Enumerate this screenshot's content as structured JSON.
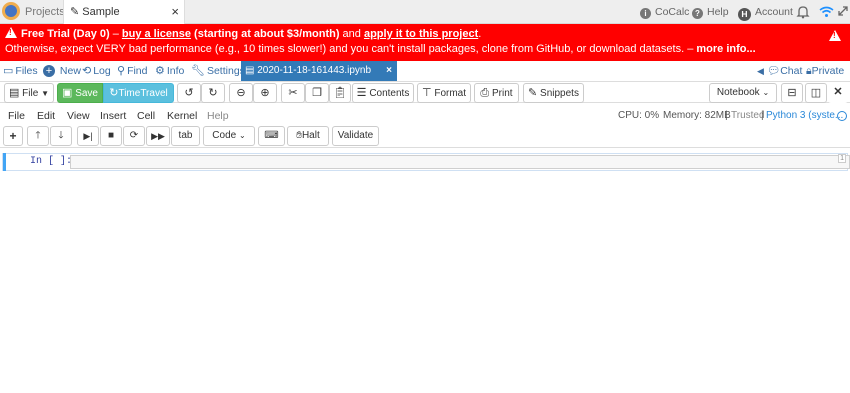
{
  "topbar": {
    "projects": "Projects",
    "tab_title": "Sample",
    "tab_close": "×",
    "cocalc": "CoCalc",
    "help": "Help",
    "avatar_initial": "H",
    "account": "Account"
  },
  "banner": {
    "line1_prefix": "Free Trial (Day 0)",
    "dash1": " – ",
    "buy_link": "buy a license",
    "pricing": " (starting at about $3/month)",
    "and": " and ",
    "apply_link": "apply it to this project",
    "period": ".",
    "line2": "Otherwise, expect VERY bad performance (e.g., 10 times slower!) and you can't install packages, clone from GitHub, or download datasets. – ",
    "more_info": "more info..."
  },
  "projnav": {
    "files": "Files",
    "new": "New",
    "log": "Log",
    "find": "Find",
    "info": "Info",
    "settings": "Settings",
    "file_tab": "2020-11-18-161443.ipynb",
    "file_tab_close": "×",
    "chat": "Chat",
    "private": "Private"
  },
  "toolbar": {
    "file": "File",
    "save": "Save",
    "timetravel": "TimeTravel",
    "contents": "Contents",
    "format": "Format",
    "print": "Print",
    "snippets": "Snippets",
    "notebook": "Notebook"
  },
  "menu": {
    "items": [
      "File",
      "Edit",
      "View",
      "Insert",
      "Cell",
      "Kernel",
      "Help"
    ],
    "cpu": "CPU: 0%",
    "memory": "Memory: 82MB",
    "trusted": "Trusted",
    "kernel": "Python 3 (syste..."
  },
  "nbtoolbar": {
    "tab": "tab",
    "code": "Code",
    "halt": "Halt",
    "validate": "Validate"
  },
  "cell": {
    "prompt": "In [ ]:",
    "line_number": "1"
  },
  "colors": {
    "banner_bg": "#ff0000",
    "accent": "#337ab7",
    "save_green": "#5cb85c",
    "timetravel_teal": "#5bc0de",
    "cell_bar": "#42a5f5"
  }
}
